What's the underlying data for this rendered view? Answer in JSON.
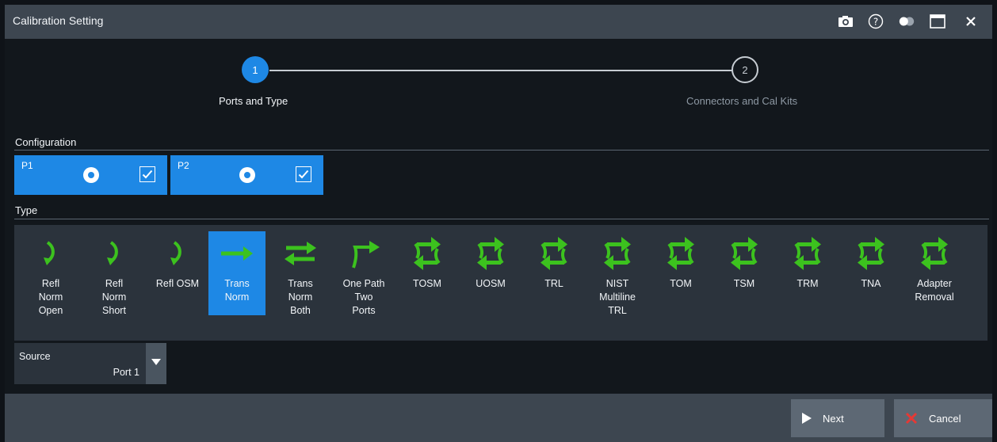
{
  "window": {
    "title": "Calibration Setting",
    "icons": [
      "camera-icon",
      "help-icon",
      "toggle-icon",
      "maximize-icon",
      "close-icon"
    ]
  },
  "wizard": {
    "steps": [
      {
        "number": "1",
        "label": "Ports and Type",
        "state": "active"
      },
      {
        "number": "2",
        "label": "Connectors and Cal Kits",
        "state": "inactive"
      }
    ]
  },
  "configuration": {
    "label": "Configuration",
    "ports": [
      {
        "name": "P1",
        "selected": true,
        "checked": true
      },
      {
        "name": "P2",
        "selected": true,
        "checked": true
      }
    ]
  },
  "type": {
    "label": "Type",
    "items": [
      {
        "label": "Refl\nNorm\nOpen",
        "icon": "reflect-arrow-icon",
        "selected": false
      },
      {
        "label": "Refl\nNorm\nShort",
        "icon": "reflect-arrow-icon",
        "selected": false
      },
      {
        "label": "Refl OSM",
        "icon": "reflect-arrow-icon",
        "selected": false
      },
      {
        "label": "Trans\nNorm",
        "icon": "right-arrow-icon",
        "selected": true
      },
      {
        "label": "Trans\nNorm\nBoth",
        "icon": "bidirectional-arrows-icon",
        "selected": false
      },
      {
        "label": "One Path\nTwo\nPorts",
        "icon": "one-path-arrow-icon",
        "selected": false
      },
      {
        "label": "TOSM",
        "icon": "full-two-port-icon",
        "selected": false
      },
      {
        "label": "UOSM",
        "icon": "full-two-port-icon",
        "selected": false
      },
      {
        "label": "TRL",
        "icon": "full-two-port-icon",
        "selected": false
      },
      {
        "label": "NIST\nMultiline\nTRL",
        "icon": "full-two-port-icon",
        "selected": false
      },
      {
        "label": "TOM",
        "icon": "full-two-port-icon",
        "selected": false
      },
      {
        "label": "TSM",
        "icon": "full-two-port-icon",
        "selected": false
      },
      {
        "label": "TRM",
        "icon": "full-two-port-icon",
        "selected": false
      },
      {
        "label": "TNA",
        "icon": "full-two-port-icon",
        "selected": false
      },
      {
        "label": "Adapter\nRemoval",
        "icon": "full-two-port-icon",
        "selected": false
      }
    ]
  },
  "source": {
    "label": "Source",
    "value": "Port 1"
  },
  "footer": {
    "next_label": "Next",
    "cancel_label": "Cancel"
  },
  "colors": {
    "accent": "#1e88e5",
    "icon_green": "#3cc21e",
    "cancel_red": "#e53935"
  }
}
